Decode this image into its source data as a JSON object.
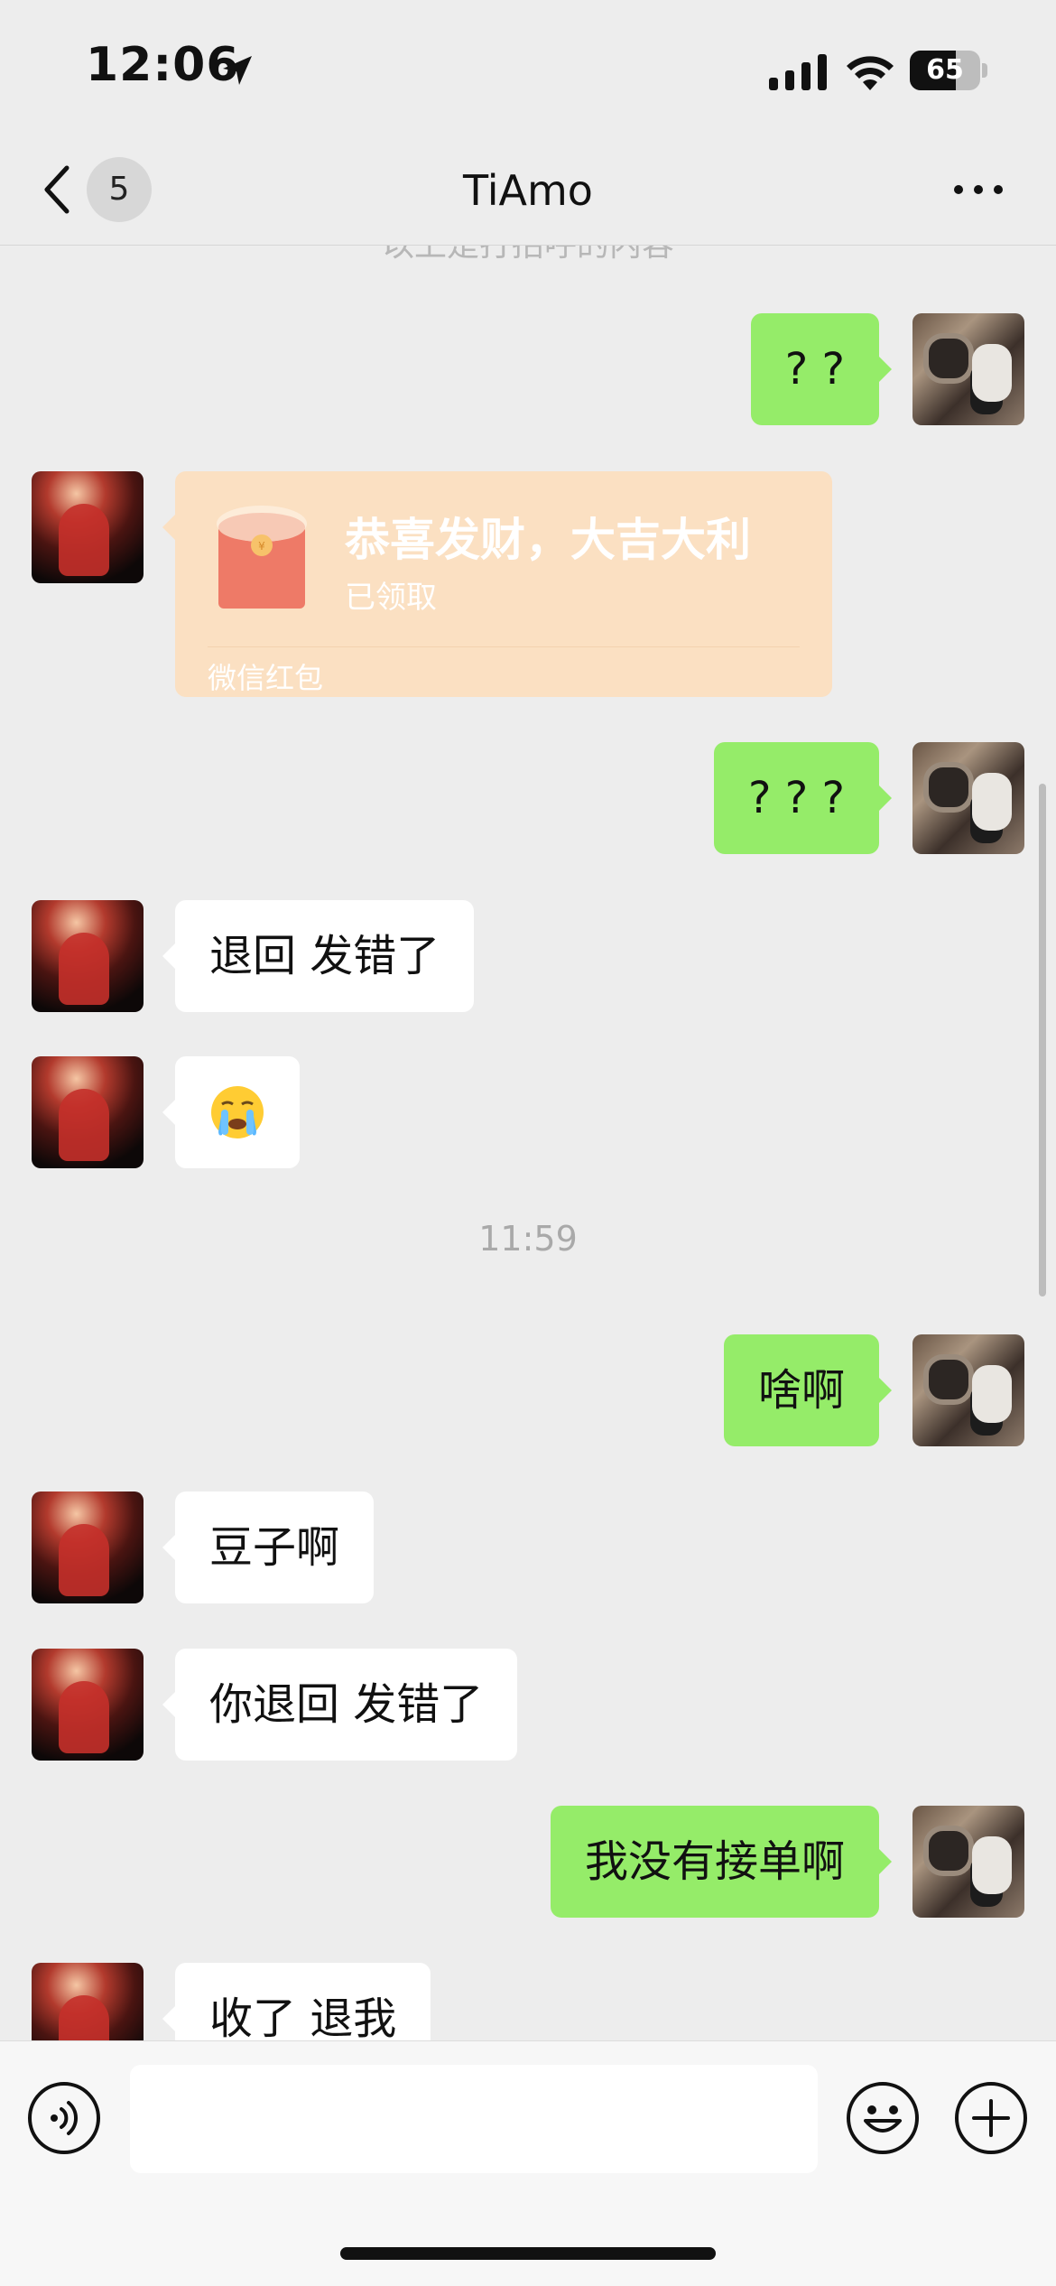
{
  "status_bar": {
    "time": "12:06",
    "battery_level": "65",
    "battery_fraction": 0.65
  },
  "nav": {
    "unread_count": "5",
    "title": "TiAmo"
  },
  "chat": {
    "cut_hint": "以上是打招呼的内容",
    "messages": [
      {
        "kind": "text",
        "from": "me",
        "text": "? ?"
      },
      {
        "kind": "red_packet",
        "from": "other",
        "title": "恭喜发财，大吉大利",
        "status": "已领取",
        "footer": "微信红包"
      },
      {
        "kind": "text",
        "from": "me",
        "text": "? ? ?"
      },
      {
        "kind": "text",
        "from": "other",
        "text": "退回 发错了"
      },
      {
        "kind": "emoji",
        "from": "other",
        "icon": "crying-face-icon"
      },
      {
        "kind": "time",
        "text": "11:59"
      },
      {
        "kind": "text",
        "from": "me",
        "text": "啥啊"
      },
      {
        "kind": "text",
        "from": "other",
        "text": "豆子啊"
      },
      {
        "kind": "text",
        "from": "other",
        "text": "你退回 发错了"
      },
      {
        "kind": "text",
        "from": "me",
        "text": "我没有接单啊"
      },
      {
        "kind": "text",
        "from": "other",
        "text": "收了 退我"
      }
    ]
  },
  "input_bar": {
    "placeholder": "",
    "icons": [
      "voice-icon",
      "emoji-icon",
      "plus-icon"
    ]
  },
  "colors": {
    "background": "#ededed",
    "outgoing_bubble": "#95ec69",
    "incoming_bubble": "#ffffff",
    "red_packet": "#fbe0c2"
  }
}
